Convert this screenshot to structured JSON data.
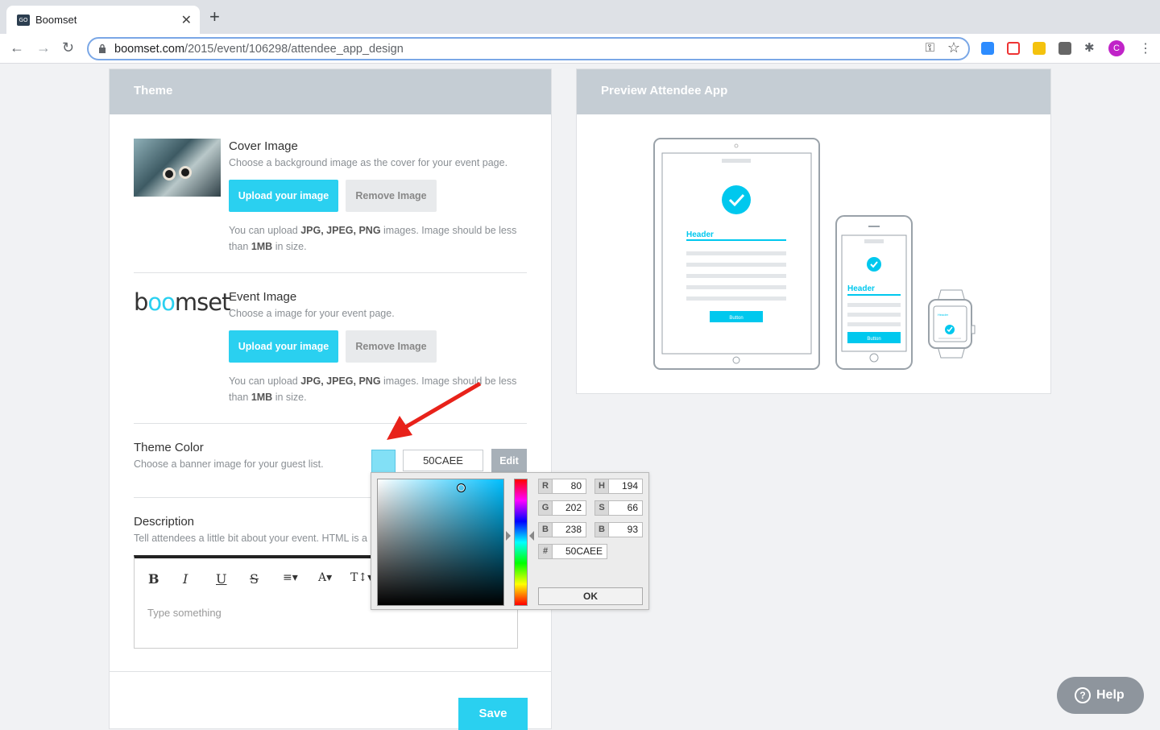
{
  "browser": {
    "tab_title": "Boomset",
    "tab_favicon": "GO",
    "url_domain": "boomset.com",
    "url_path": "/2015/event/106298/attendee_app_design",
    "profile_initial": "C"
  },
  "theme_card": {
    "title": "Theme",
    "cover": {
      "title": "Cover Image",
      "desc": "Choose a background image as the cover for your event page.",
      "upload_label": "Upload your image",
      "remove_label": "Remove Image",
      "note_pre": "You can upload ",
      "note_formats": "JPG, JPEG, PNG",
      "note_mid": " images. Image should be less than ",
      "note_size": "1MB",
      "note_post": " in size."
    },
    "event": {
      "logo_a": "b",
      "logo_o": "oo",
      "logo_b": "mset",
      "title": "Event Image",
      "desc": "Choose a image for your event page.",
      "upload_label": "Upload your image",
      "remove_label": "Remove Image",
      "note_pre": "You can upload ",
      "note_formats": "JPG, JPEG, PNG",
      "note_mid": " images. Image should be less than ",
      "note_size": "1MB",
      "note_post": " in size."
    },
    "theme_color": {
      "title": "Theme Color",
      "desc": "Choose a banner image for your guest list.",
      "hex_value": "50CAEE",
      "edit_label": "Edit",
      "swatch_color": "#82e0f6"
    },
    "description": {
      "title": "Description",
      "desc": "Tell attendees a little bit about your event. HTML is a",
      "toolbar": [
        "B",
        "I",
        "U",
        "S",
        "≡▾",
        "A▾",
        "T↕▾"
      ],
      "placeholder": "Type something"
    },
    "save_label": "Save"
  },
  "color_picker": {
    "r": "80",
    "g": "202",
    "b": "238",
    "h": "194",
    "s": "66",
    "bv": "93",
    "hex": "50CAEE",
    "labels": {
      "r": "R",
      "g": "G",
      "b": "B",
      "h": "H",
      "s": "S",
      "bv": "B",
      "hex": "#"
    },
    "ok_label": "OK"
  },
  "preview_card": {
    "title": "Preview Attendee App",
    "tablet_header": "Header",
    "tablet_button": "Button",
    "phone_header": "Header",
    "phone_button": "Button",
    "watch_header": "Header",
    "accent_color": "#00c8ee"
  },
  "help": {
    "label": "Help",
    "icon": "?"
  }
}
